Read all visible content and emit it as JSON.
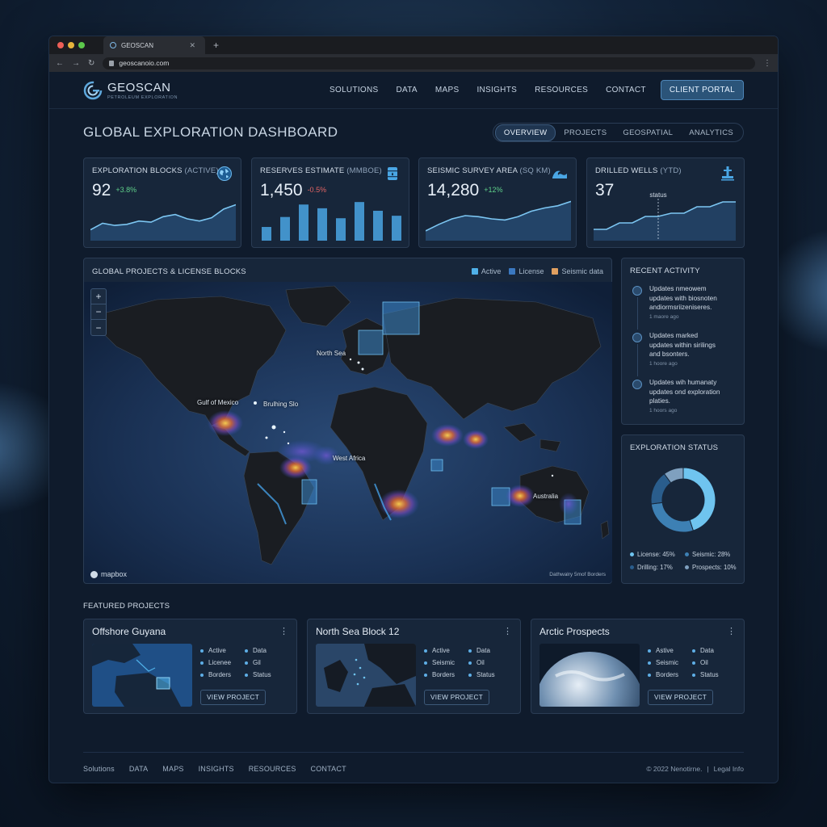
{
  "browser": {
    "tab_title": "GEOSCAN",
    "url": "geoscanoio.com",
    "traffic_colors": [
      "#ec5f57",
      "#e6b43c",
      "#5cc84b"
    ]
  },
  "header": {
    "brand": "GEOSCAN",
    "tagline": "PETROLEUM EXPLORATION",
    "nav": [
      "SOLUTIONS",
      "DATA",
      "MAPS",
      "INSIGHTS",
      "RESOURCES",
      "CONTACT"
    ],
    "portal_label": "CLIENT PORTAL"
  },
  "page": {
    "title": "GLOBAL EXPLORATION DASHBOARD",
    "tabs": [
      "OVERVIEW",
      "PROJECTS",
      "GEOSPATIAL",
      "ANALYTICS"
    ],
    "active_tab": "OVERVIEW"
  },
  "kpis": [
    {
      "label": "EXPLORATION BLOCKS",
      "unit": "(ACTIVE)",
      "value": "92",
      "delta": "+3.8%",
      "trend": "up",
      "icon": "globe-icon",
      "sparkline": [
        20,
        32,
        28,
        30,
        36,
        34,
        44,
        48,
        40,
        36,
        42,
        58,
        66
      ]
    },
    {
      "label": "RESERVES ESTIMATE",
      "unit": "(MMBOE)",
      "value": "1,450",
      "delta": "-0.5%",
      "trend": "down",
      "icon": "oil-barrel-icon",
      "bars": [
        22,
        38,
        58,
        52,
        36,
        62,
        48,
        40
      ]
    },
    {
      "label": "SEISMIC SURVEY AREA",
      "unit": "(SQ KM)",
      "value": "14,280",
      "delta": "+12%",
      "trend": "up",
      "icon": "wave-icon",
      "sparkline": [
        18,
        30,
        40,
        46,
        44,
        40,
        38,
        44,
        54,
        60,
        64,
        72
      ]
    },
    {
      "label": "DRILLED WELLS",
      "unit": "(YTD)",
      "value": "37",
      "delta": "",
      "trend": "none",
      "icon": "drill-rig-icon",
      "annotation": "status",
      "steps": [
        14,
        14,
        22,
        22,
        30,
        30,
        34,
        34,
        42,
        42,
        48,
        48
      ]
    }
  ],
  "map": {
    "title": "GLOBAL PROJECTS & LICENSE BLOCKS",
    "legend": [
      {
        "label": "Active",
        "color": "#4fb0e8"
      },
      {
        "label": "License",
        "color": "#3a78c0"
      },
      {
        "label": "Seismic data",
        "color": "#e0a060"
      }
    ],
    "labels": [
      "North Sea",
      "Gulf of Mexico",
      "Brulhing Slo",
      "West Africa",
      "Australia"
    ],
    "brand": "mapbox",
    "attribution": "Dathwalry 5mof Borders"
  },
  "activity": {
    "title": "RECENT ACTIVITY",
    "items": [
      {
        "line1": "Updates nmeowem",
        "line2": "updates with biosnoten",
        "line3": "andiormsriizeniseres.",
        "time": "1 maore ago"
      },
      {
        "line1": "Updates marked",
        "line2": "updates within sirilings",
        "line3": "and bsonters.",
        "time": "1 hoore ago"
      },
      {
        "line1": "Updates wih humanaty",
        "line2": "updates ond exploration",
        "line3": "platies.",
        "time": "1 hoors ago"
      }
    ]
  },
  "status": {
    "title": "EXPLORATION STATUS",
    "slices": [
      {
        "label": "License",
        "value": 45,
        "text": "License: 45%",
        "color": "#6fc4ef"
      },
      {
        "label": "Seismic",
        "value": 28,
        "text": "Seismic: 28%",
        "color": "#3d80b4"
      },
      {
        "label": "Drilling",
        "value": 17,
        "text": "Drilling: 17%",
        "color": "#2a5d8c"
      },
      {
        "label": "Prospects",
        "value": 10,
        "text": "Prospects: 10%",
        "color": "#7fa0bf"
      }
    ]
  },
  "featured": {
    "title": "FEATURED PROJECTS",
    "projects": [
      {
        "name": "Offshore Guyana",
        "meta": [
          "Active",
          "Data",
          "Licenee",
          "Gil",
          "Borders",
          "Status"
        ],
        "button": "VIEW PROJECT"
      },
      {
        "name": "North Sea Block 12",
        "meta": [
          "Active",
          "Data",
          "Seismic",
          "Oil",
          "Borders",
          "Status"
        ],
        "button": "VIEW PROJECT"
      },
      {
        "name": "Arctic Prospects",
        "meta": [
          "Astive",
          "Data",
          "Seismic",
          "Oil",
          "Borders",
          "Status"
        ],
        "button": "VIEW PROJECT"
      }
    ]
  },
  "footer": {
    "links": [
      "Solutions",
      "DATA",
      "MAPS",
      "INSIGHTS",
      "RESOURCES",
      "CONTACT"
    ],
    "copyright": "© 2022 Nenotirne.",
    "legal": "Legal Info"
  }
}
